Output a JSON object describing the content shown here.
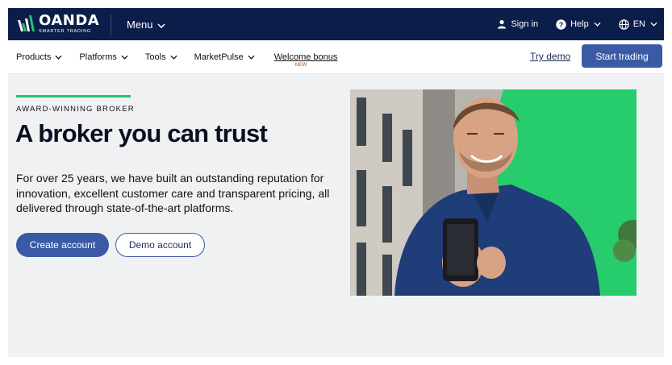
{
  "brand": {
    "name": "OANDA",
    "tagline": "SMARTER TRADING"
  },
  "topbar": {
    "menu_label": "Menu",
    "sign_in": "Sign in",
    "help": "Help",
    "language": "EN"
  },
  "subnav": {
    "items": [
      {
        "label": "Products"
      },
      {
        "label": "Platforms"
      },
      {
        "label": "Tools"
      },
      {
        "label": "MarketPulse"
      }
    ],
    "welcome_bonus": "Welcome bonus",
    "welcome_badge": "NEW",
    "try_demo": "Try demo",
    "start_trading": "Start trading"
  },
  "hero": {
    "eyebrow": "AWARD-WINNING BROKER",
    "headline": "A broker you can trust",
    "description": "For over 25 years, we have built an outstanding reputation for innovation, excellent customer care and transparent pricing, all delivered through state-of-the-art platforms.",
    "primary_cta": "Create account",
    "secondary_cta": "Demo account"
  },
  "colors": {
    "navy": "#0b1e4a",
    "brand_blue": "#3a5aa5",
    "accent_green": "#26c172",
    "hero_bg": "#f0f1f3",
    "badge_orange": "#e8792b"
  },
  "icons": {
    "logo": "oanda-logo-icon",
    "user": "user-icon",
    "help": "question-circle-icon",
    "language": "globe-icon",
    "dropdown": "chevron-down-icon"
  }
}
